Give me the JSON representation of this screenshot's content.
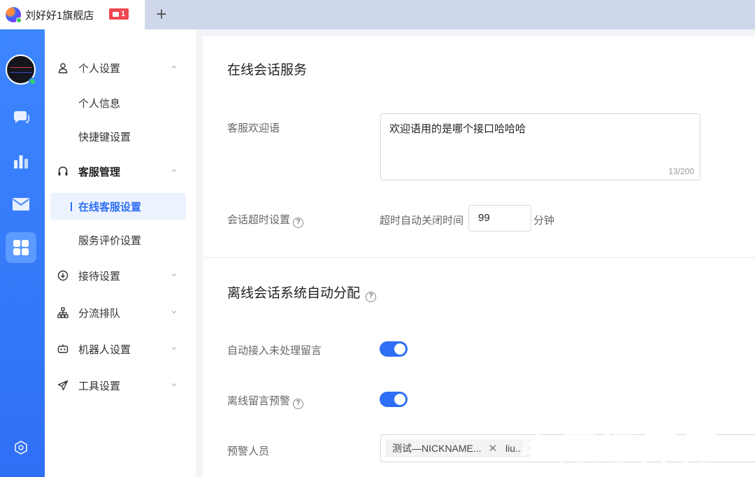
{
  "tabbar": {
    "title": "刘好好1旗舰店",
    "badge": "1",
    "add": "+"
  },
  "rail": {
    "items": [
      {
        "icon": "chat-icon"
      },
      {
        "icon": "chart-icon"
      },
      {
        "icon": "mail-icon"
      },
      {
        "icon": "grid-icon",
        "active": true
      },
      {
        "icon": "settings-hexagon-icon"
      }
    ]
  },
  "menu": {
    "personal": "个人设置",
    "personal_info": "个人信息",
    "shortcut": "快捷键设置",
    "cs_manage": "客服管理",
    "online_cs": "在线客服设置",
    "service_eval": "服务评价设置",
    "reception": "接待设置",
    "queue": "分流排队",
    "robot": "机器人设置",
    "tools": "工具设置"
  },
  "online_session": {
    "title": "在线会话服务",
    "welcome_label": "客服欢迎语",
    "welcome_value": "欢迎语用的是哪个接口哈哈哈",
    "welcome_counter": "13/200",
    "timeout_label": "会话超时设置",
    "timeout_prefix": "超时自动关闭时间",
    "timeout_value": "99",
    "timeout_unit": "分钟"
  },
  "offline_session": {
    "title": "离线会话系统自动分配",
    "auto_accept_label": "自动接入未处理留言",
    "auto_accept_on": true,
    "offline_warn_label": "离线留言预警",
    "offline_warn_on": true,
    "warn_people_label": "预警人员",
    "tags": [
      "测试—NICKNAME...",
      "liu..."
    ]
  },
  "watermark": "电商运营官"
}
